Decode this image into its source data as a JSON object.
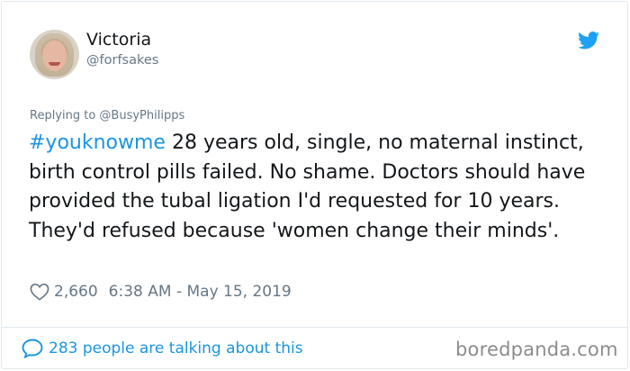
{
  "author": {
    "display_name": "Victoria",
    "handle": "@forfsakes"
  },
  "reply_to": "Replying to @BusyPhilipps",
  "tweet": {
    "hashtag": "#youknowme",
    "body": " 28 years old, single, no maternal instinct, birth control pills failed. No shame. Doctors should have provided the tubal ligation I'd requested for 10 years. They'd refused because 'women change their minds'."
  },
  "meta": {
    "likes": "2,660",
    "timestamp": "6:38 AM - May 15, 2019"
  },
  "footer": {
    "talking": "283 people are talking about this"
  },
  "watermark": "boredpanda.com",
  "colors": {
    "twitter_blue": "#1b95e0",
    "secondary_text": "#657786"
  },
  "icons": [
    "twitter-bird-icon",
    "heart-icon",
    "speech-bubble-icon"
  ]
}
